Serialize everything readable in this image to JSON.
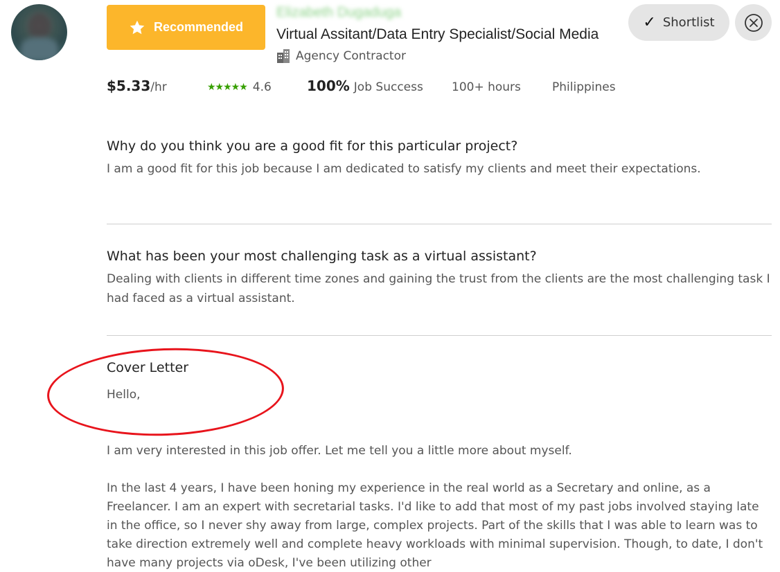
{
  "candidate": {
    "name": "Elizabeth Dugaduga",
    "badge": "Recommended",
    "title": "Virtual Assitant/Data Entry Specialist/Social Media",
    "type": "Agency Contractor"
  },
  "actions": {
    "shortlist": "Shortlist"
  },
  "stats": {
    "rate_value": "$5.33",
    "rate_unit": "/hr",
    "stars": "★★★★★",
    "rating": "4.6",
    "job_success_value": "100%",
    "job_success_label": "Job Success",
    "hours": "100+ hours",
    "country": "Philippines"
  },
  "questions": [
    {
      "question": "Why do you think you are a good fit for this particular project?",
      "answer": "I am a good fit for this job because I am dedicated to satisfy my clients and meet their expectations."
    },
    {
      "question": "What has been your most challenging task as a virtual assistant?",
      "answer": "Dealing with clients in different time zones and gaining the trust from the clients are the most challenging task I had faced as a virtual assistant."
    }
  ],
  "cover_letter": {
    "title": "Cover Letter",
    "greeting": "Hello,",
    "paragraph1": "I am very interested in this job offer. Let me tell you a little more about myself.",
    "paragraph2": "In the last 4 years, I have been honing my experience in the real world as a Secretary and online, as a Freelancer. I am an expert with secretarial tasks. I'd like to add that most of my past jobs involved staying late in the office, so I never shy away from large, complex projects. Part of the skills that I was able to learn was to take direction extremely well and complete heavy workloads with minimal supervision. Though, to date, I don't have many projects via oDesk, I've been utilizing other"
  },
  "colors": {
    "badge": "#fcb62b",
    "stars": "#37a000",
    "annotation": "#e8141c"
  },
  "icons": {
    "badge": "star-icon",
    "agency": "building-icon",
    "shortlist": "checkmark-icon",
    "dismiss": "close-circle-icon"
  }
}
